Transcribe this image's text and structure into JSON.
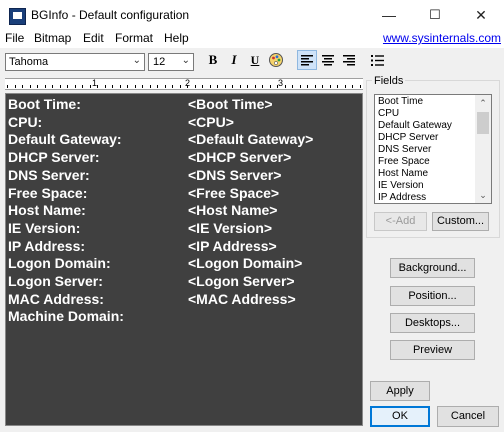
{
  "window": {
    "title": "BGInfo - Default configuration",
    "controls": {
      "minimize": "—",
      "maximize": "☐",
      "close": "✕"
    }
  },
  "menu": {
    "items": [
      "File",
      "Bitmap",
      "Edit",
      "Format",
      "Help"
    ],
    "link": "www.sysinternals.com"
  },
  "toolbar": {
    "font": "Tahoma",
    "size": "12",
    "bold": "B",
    "italic": "I",
    "underline": "U",
    "align_left_pressed": true
  },
  "ruler": {
    "labels": [
      "1",
      "2",
      "3"
    ]
  },
  "editor": {
    "background": "#404040",
    "text_color": "#ffffff",
    "rows": [
      {
        "label": "Boot Time:",
        "value": "<Boot Time>"
      },
      {
        "label": "CPU:",
        "value": "<CPU>"
      },
      {
        "label": "Default Gateway:",
        "value": "<Default Gateway>"
      },
      {
        "label": "DHCP Server:",
        "value": "<DHCP Server>"
      },
      {
        "label": "DNS Server:",
        "value": "<DNS Server>"
      },
      {
        "label": "Free Space:",
        "value": "<Free Space>"
      },
      {
        "label": "Host Name:",
        "value": "<Host Name>"
      },
      {
        "label": "IE Version:",
        "value": "<IE Version>"
      },
      {
        "label": "IP Address:",
        "value": "<IP Address>"
      },
      {
        "label": "Logon Domain:",
        "value": "<Logon Domain>"
      },
      {
        "label": "Logon Server:",
        "value": "<Logon Server>"
      },
      {
        "label": "MAC Address:",
        "value": "<MAC Address>"
      },
      {
        "label": "Machine Domain:",
        "value": ""
      }
    ]
  },
  "fields": {
    "title": "Fields",
    "items": [
      "Boot Time",
      "CPU",
      "Default Gateway",
      "DHCP Server",
      "DNS Server",
      "Free Space",
      "Host Name",
      "IE Version",
      "IP Address"
    ],
    "add_label": "<-Add",
    "custom_label": "Custom..."
  },
  "buttons": {
    "background": "Background...",
    "position": "Position...",
    "desktops": "Desktops...",
    "preview": "Preview",
    "apply": "Apply",
    "ok": "OK",
    "cancel": "Cancel"
  }
}
